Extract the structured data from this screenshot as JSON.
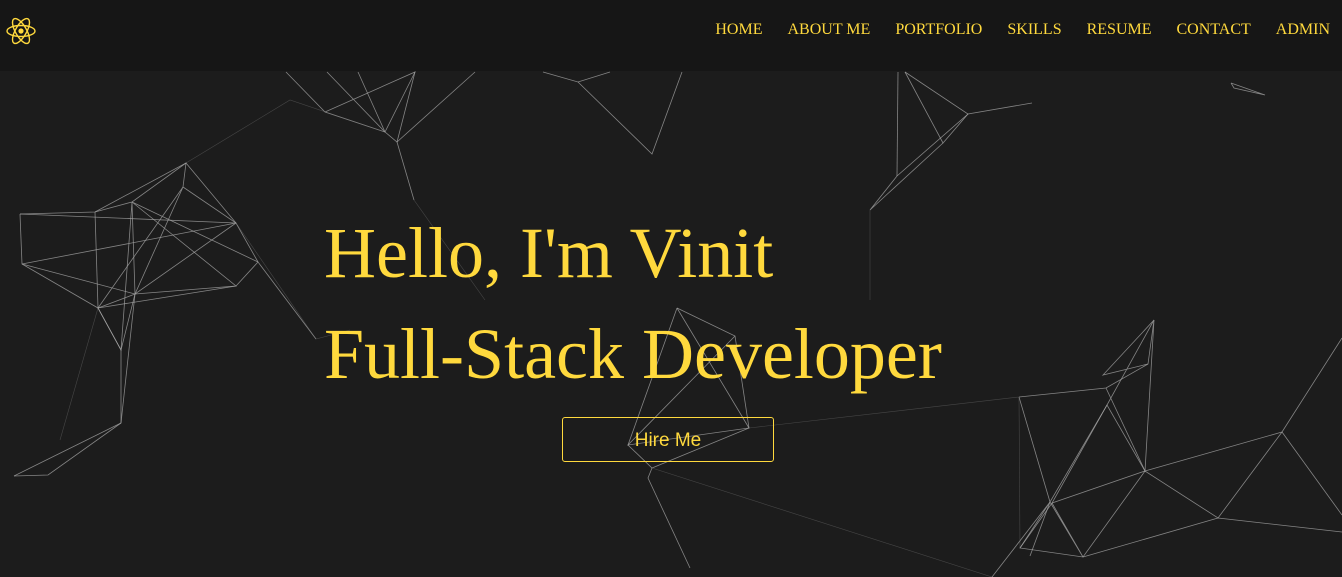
{
  "navbar": {
    "logo_icon": "react-atom-icon",
    "links": [
      {
        "label": "HOME"
      },
      {
        "label": "ABOUT ME"
      },
      {
        "label": "PORTFOLIO"
      },
      {
        "label": "SKILLS"
      },
      {
        "label": "RESUME"
      },
      {
        "label": "CONTACT"
      },
      {
        "label": "ADMIN"
      }
    ]
  },
  "hero": {
    "greeting": "Hello, I'm Vinit",
    "role": "Full-Stack Developer",
    "cta_label": "Hire Me"
  },
  "colors": {
    "background": "#1c1c1c",
    "navbar_background": "#161616",
    "accent": "#ffd93d",
    "network_lines": "#9a9a9a"
  }
}
